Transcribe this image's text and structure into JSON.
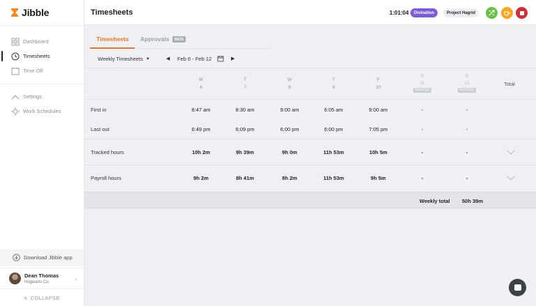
{
  "app": {
    "name": "Jibble"
  },
  "sidebar": {
    "items": [
      {
        "label": "Dashboard",
        "icon": "dashboard-icon"
      },
      {
        "label": "Timesheets",
        "icon": "clock-icon",
        "active": true
      },
      {
        "label": "Time Off",
        "icon": "calendar-icon"
      },
      {
        "label": "Settings",
        "icon": "settings-icon"
      },
      {
        "label": "Work Schedules",
        "icon": "schedule-icon"
      }
    ],
    "download_label": "Download Jibble app",
    "user": {
      "name": "Dean Thomas",
      "org": "Hogwarts Co"
    },
    "collapse_label": "COLLAPSE"
  },
  "header": {
    "title": "Timesheets",
    "timer": "1:01:04",
    "activity": "Divination",
    "project": "Project Hagrid"
  },
  "tabs": [
    {
      "label": "Timesheets",
      "active": true
    },
    {
      "label": "Approvals",
      "badge": "BETA"
    }
  ],
  "filter": {
    "view": "Weekly Timesheets",
    "range": "Feb 6 - Feb 12"
  },
  "columns": [
    {
      "day": "M",
      "date": "6"
    },
    {
      "day": "T",
      "date": "7"
    },
    {
      "day": "W",
      "date": "8"
    },
    {
      "day": "T",
      "date": "9"
    },
    {
      "day": "F",
      "date": "10"
    },
    {
      "day": "S",
      "date": "11",
      "tag": "Rest Day"
    },
    {
      "day": "S",
      "date": "12",
      "tag": "Rest Day"
    }
  ],
  "total_header": "Total",
  "rows": {
    "first_in": {
      "label": "First in",
      "values": [
        "8:47 am",
        "8:30 am",
        "9:00 am",
        "6:05 am",
        "9:00 am",
        "-",
        "-"
      ]
    },
    "last_out": {
      "label": "Last out",
      "values": [
        "6:49 pm",
        "6:09 pm",
        "6:00 pm",
        "6:00 pm",
        "7:05 pm",
        "-",
        "-"
      ]
    },
    "tracked": {
      "label": "Tracked hours",
      "values": [
        "10h 2m",
        "9h 39m",
        "9h 0m",
        "11h 53m",
        "10h 5m",
        "-",
        "-"
      ],
      "total": "-"
    },
    "payroll": {
      "label": "Payroll hours",
      "values": [
        "9h 2m",
        "8h 41m",
        "8h 2m",
        "11h 53m",
        "9h 5m",
        "-",
        "-"
      ],
      "total": "-"
    }
  },
  "weekly_total": {
    "label": "Weekly total",
    "value": "50h 39m"
  },
  "colors": {
    "accent": "#e8742a",
    "activity": "#7b5cd6",
    "stop": "#c8323c"
  }
}
